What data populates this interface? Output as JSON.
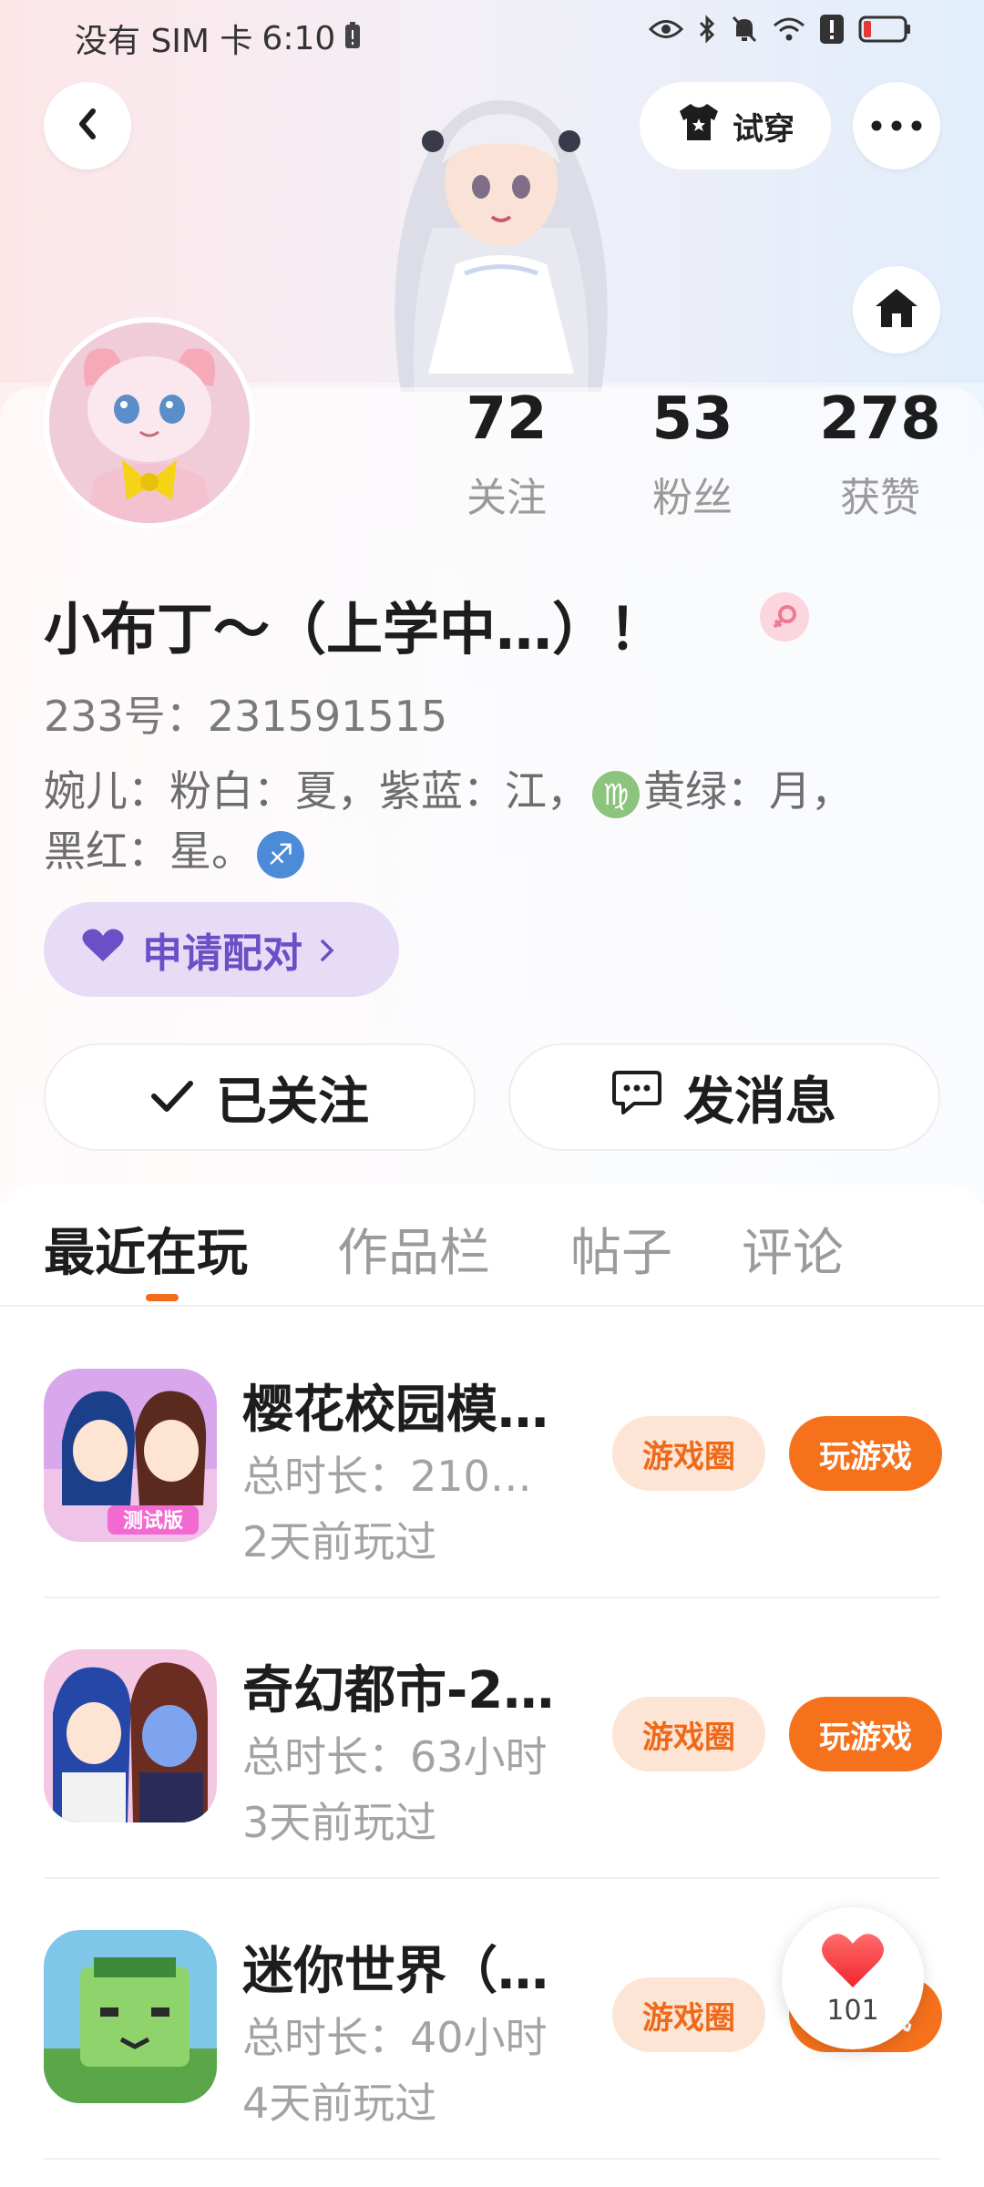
{
  "status_bar": {
    "carrier": "没有 SIM 卡",
    "time": "6:10"
  },
  "header": {
    "tryon_label": "试穿"
  },
  "stats": [
    {
      "value": "72",
      "label": "关注"
    },
    {
      "value": "53",
      "label": "粉丝"
    },
    {
      "value": "278",
      "label": "获赞"
    }
  ],
  "profile": {
    "name": "小布丁～（上学中…）！",
    "uid": "233号：231591515",
    "bio_part1": "婉儿：粉白：夏，紫蓝：江，",
    "bio_icon1": "♍",
    "bio_part2": "黄绿：月，黑红：星。",
    "bio_icon2": "♐",
    "pair_label": "申请配对"
  },
  "actions": {
    "follow_label": "已关注",
    "message_label": "发消息"
  },
  "tabs": [
    "最近在玩",
    "作品栏",
    "帖子",
    "评论"
  ],
  "games": [
    {
      "title": "樱花校园模…",
      "playtime": "总时长：210…",
      "last_played": "2天前玩过",
      "circle_label": "游戏圈",
      "play_label": "玩游戏"
    },
    {
      "title": "奇幻都市-2…",
      "playtime": "总时长：63小时",
      "last_played": "3天前玩过",
      "circle_label": "游戏圈",
      "play_label": "玩游戏"
    },
    {
      "title": "迷你世界（…",
      "playtime": "总时长：40小时",
      "last_played": "4天前玩过",
      "circle_label": "游戏圈",
      "play_label": "玩游戏"
    }
  ],
  "like_fab": {
    "count": "101"
  },
  "colors": {
    "accent": "#f5711c",
    "accent_light": "#fde5d6",
    "pair_bg": "#e6dcf6",
    "pair_text": "#6a4fc7"
  }
}
